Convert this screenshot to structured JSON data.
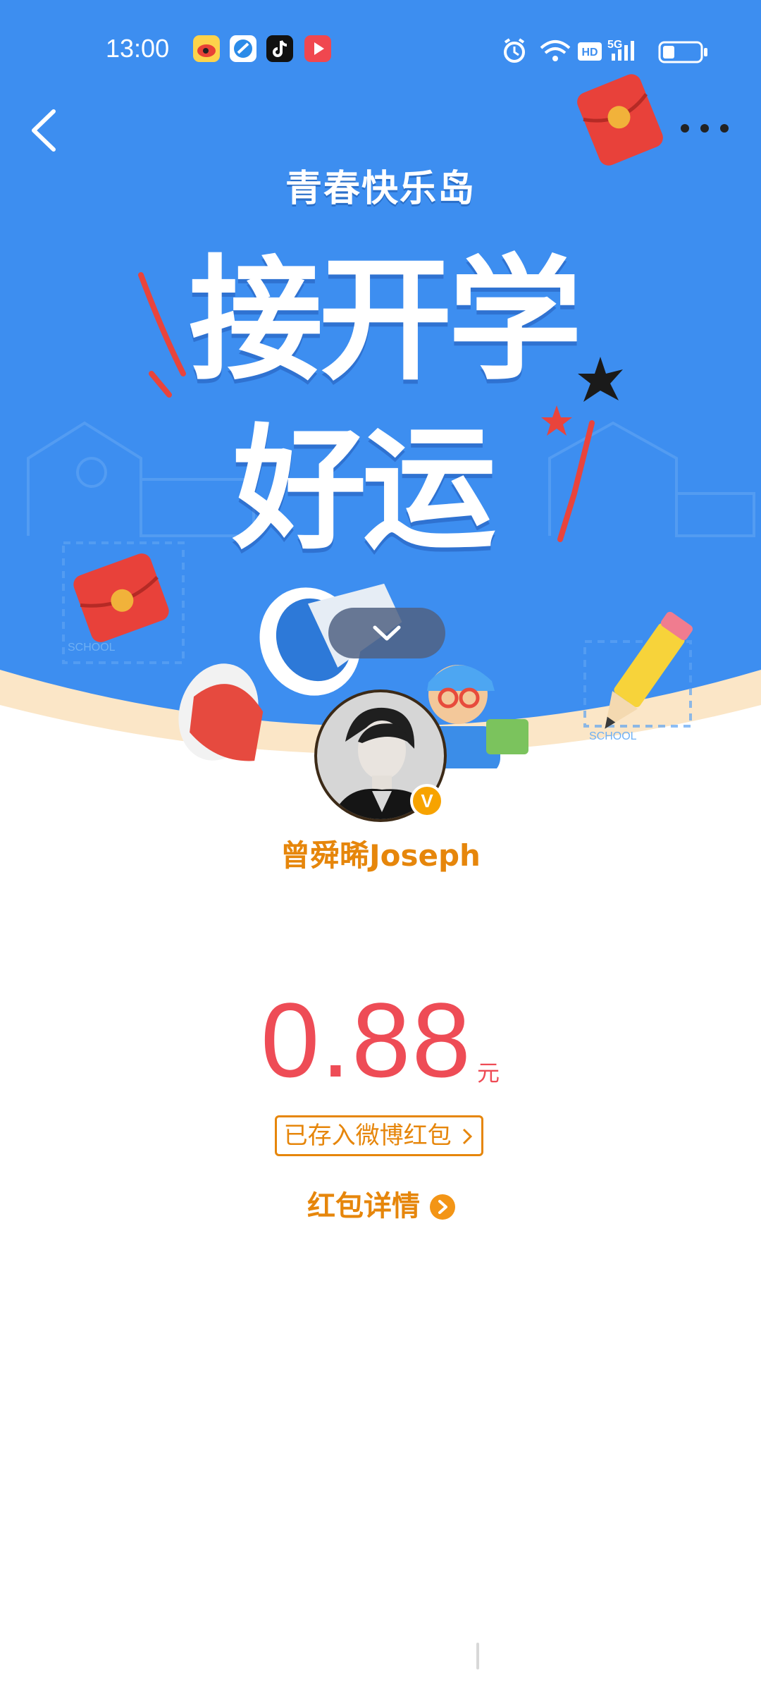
{
  "status_bar": {
    "time": "13:00",
    "apps": [
      "weibo-app-icon",
      "browser-app-icon",
      "tiktok-app-icon",
      "video-app-icon"
    ],
    "indicators": [
      "alarm-icon",
      "wifi-icon",
      "hd-icon",
      "5g-signal-icon",
      "battery-icon"
    ],
    "hd_label": "HD",
    "network_label": "5G"
  },
  "nav": {
    "back_icon": "chevron-left-icon",
    "more_icon": "more-dots-icon"
  },
  "banner": {
    "subtitle": "青春快乐岛",
    "title_line1": "接开学",
    "title_line2": "好运",
    "school_label": "SCHOOL",
    "collapse_icon": "chevron-down-icon"
  },
  "sender": {
    "name": "曾舜晞Joseph",
    "verified_badge": "V"
  },
  "packet": {
    "amount": "0.88",
    "currency": "元",
    "deposit_label": "已存入微博红包",
    "detail_label": "红包详情"
  },
  "colors": {
    "banner_blue": "#3d8ef0",
    "accent_orange": "#e6860b",
    "amount_red": "#ee4c56"
  }
}
